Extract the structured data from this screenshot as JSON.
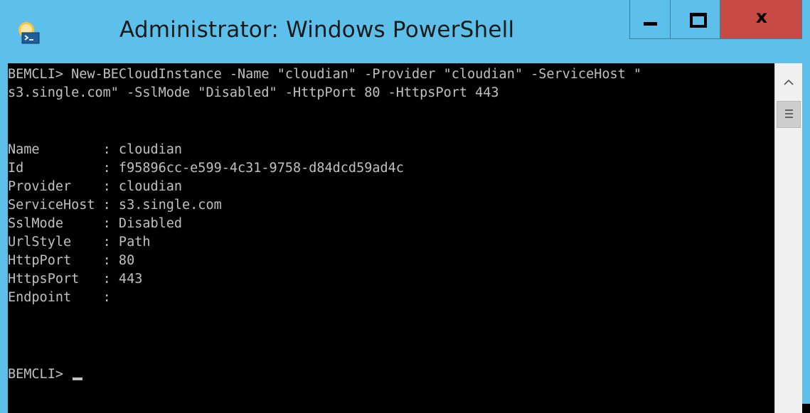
{
  "window": {
    "title": "Administrator: Windows PowerShell",
    "icon": "powershell-icon",
    "controls": {
      "minimize_icon": "minimize-icon",
      "maximize_icon": "maximize-icon",
      "close_label": "x"
    },
    "colors": {
      "titlebar": "#5cc0ea",
      "close_button": "#c74b44",
      "console_bg": "#000000",
      "console_text": "#c0c0c0"
    }
  },
  "console": {
    "lines": [
      "BEMCLI> New-BECloudInstance -Name \"cloudian\" -Provider \"cloudian\" -ServiceHost \"",
      "s3.single.com\" -SslMode \"Disabled\" -HttpPort 80 -HttpsPort 443",
      "",
      "",
      "Name        : cloudian",
      "Id          : f95896cc-e599-4c31-9758-d84dcd59ad4c",
      "Provider    : cloudian",
      "ServiceHost : s3.single.com",
      "SslMode     : Disabled",
      "UrlStyle    : Path",
      "HttpPort    : 80",
      "HttpsPort   : 443",
      "Endpoint    :",
      "",
      "",
      "",
      "BEMCLI> "
    ]
  },
  "scrollbar": {
    "up_arrow": "^",
    "up_icon": "chevron-up-icon",
    "thumb_icon": "grip-icon"
  }
}
